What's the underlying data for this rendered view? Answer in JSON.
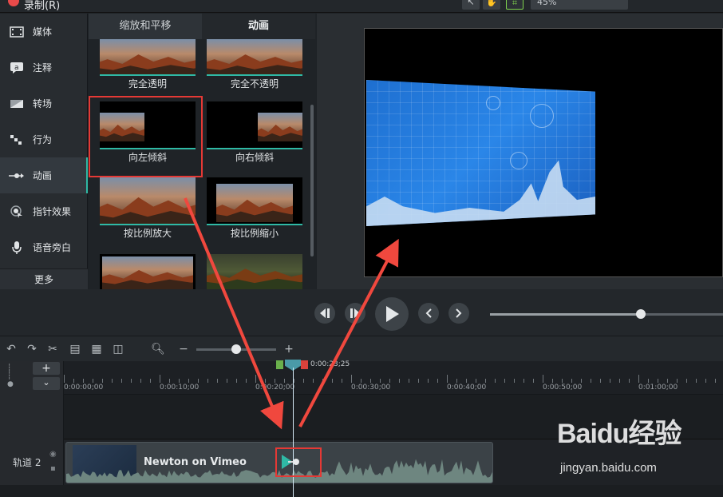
{
  "topbar": {
    "record_label": "录制(R)",
    "zoom_value": "45%"
  },
  "sidebar": {
    "items": [
      {
        "label": "媒体",
        "icon": "film-icon"
      },
      {
        "label": "注释",
        "icon": "annotation-icon"
      },
      {
        "label": "转场",
        "icon": "transition-icon"
      },
      {
        "label": "行为",
        "icon": "behavior-icon"
      },
      {
        "label": "动画",
        "icon": "animation-icon"
      },
      {
        "label": "指针效果",
        "icon": "cursor-effect-icon"
      },
      {
        "label": "语音旁白",
        "icon": "microphone-icon"
      }
    ],
    "more_label": "更多",
    "active_index": 4
  },
  "library": {
    "tabs": [
      "缩放和平移",
      "动画"
    ],
    "active_tab": 1,
    "thumbnails": [
      {
        "caption": "完全透明"
      },
      {
        "caption": "完全不透明"
      },
      {
        "caption": "向左倾斜"
      },
      {
        "caption": "向右倾斜"
      },
      {
        "caption": "按比例放大"
      },
      {
        "caption": "按比例缩小"
      },
      {
        "caption": ""
      },
      {
        "caption": ""
      }
    ],
    "highlighted_caption": "向左倾斜"
  },
  "timeline": {
    "playhead_time": "0:00:23;25",
    "ruler_labels": [
      "0:00:00;00",
      "0:00:10;00",
      "0:00:20;00",
      "0:00:30;00",
      "0:00:40;00",
      "0:00:50;00",
      "0:01:00;00"
    ],
    "track_label": "轨道 2",
    "clip_title": "Newton on Vimeo"
  },
  "watermark": {
    "brand": "Baidu经验",
    "url": "jingyan.baidu.com"
  },
  "colors": {
    "accent": "#2fb9a5",
    "highlight": "#e53935",
    "record": "#e84a4a"
  }
}
